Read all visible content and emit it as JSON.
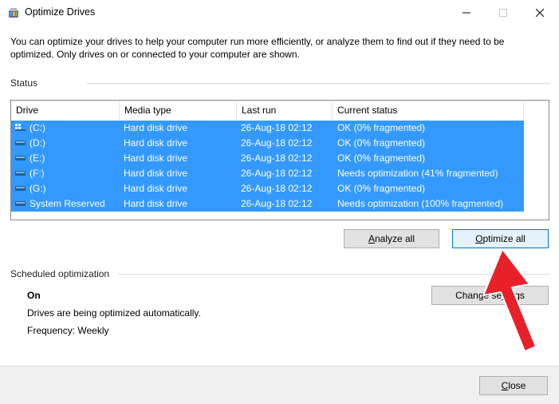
{
  "window": {
    "title": "Optimize Drives",
    "controls": {
      "minimize": "minimize",
      "maximize": "maximize",
      "close": "close"
    }
  },
  "intro": "You can optimize your drives to help your computer run more efficiently, or analyze them to find out if they need to be optimized. Only drives on or connected to your computer are shown.",
  "status": {
    "label": "Status",
    "columns": [
      "Drive",
      "Media type",
      "Last run",
      "Current status"
    ],
    "drives": [
      {
        "drive": "(C:)",
        "media_type": "Hard disk drive",
        "last_run": "26-Aug-18 02:12",
        "current_status": "OK (0% fragmented)",
        "icon": "windows-drive-icon"
      },
      {
        "drive": "(D:)",
        "media_type": "Hard disk drive",
        "last_run": "26-Aug-18 02:12",
        "current_status": "OK (0% fragmented)",
        "icon": "drive-icon"
      },
      {
        "drive": "(E:)",
        "media_type": "Hard disk drive",
        "last_run": "26-Aug-18 02:12",
        "current_status": "OK (0% fragmented)",
        "icon": "drive-icon"
      },
      {
        "drive": "(F:)",
        "media_type": "Hard disk drive",
        "last_run": "26-Aug-18 02:12",
        "current_status": "Needs optimization (41% fragmented)",
        "icon": "drive-icon"
      },
      {
        "drive": "(G:)",
        "media_type": "Hard disk drive",
        "last_run": "26-Aug-18 02:12",
        "current_status": "OK (0% fragmented)",
        "icon": "drive-icon"
      },
      {
        "drive": "System Reserved",
        "media_type": "Hard disk drive",
        "last_run": "26-Aug-18 02:12",
        "current_status": "Needs optimization (100% fragmented)",
        "icon": "drive-icon"
      }
    ]
  },
  "buttons": {
    "analyze_all": {
      "accel": "A",
      "rest": "nalyze all"
    },
    "optimize_all": {
      "accel": "O",
      "rest": "ptimize all"
    },
    "change_settings": {
      "before": "Change se",
      "accel": "t",
      "rest": "tings"
    },
    "close": {
      "accel": "C",
      "rest": "lose"
    }
  },
  "scheduled": {
    "label": "Scheduled optimization",
    "state": "On",
    "description": "Drives are being optimized automatically.",
    "frequency": "Frequency: Weekly"
  },
  "colors": {
    "selection": "#3399ff",
    "annotation_arrow": "#e8202a",
    "default_button_border": "#0078d7"
  }
}
